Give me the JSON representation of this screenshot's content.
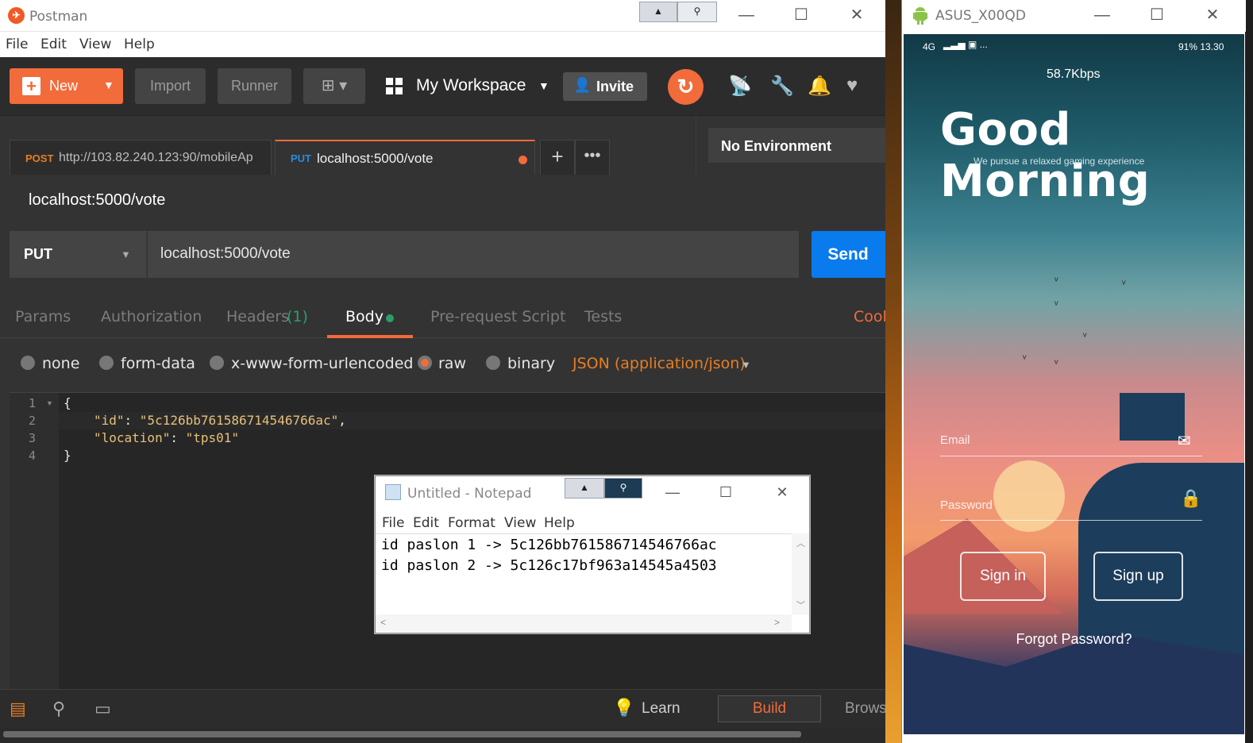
{
  "postman": {
    "window_title": "Postman",
    "menu": [
      "File",
      "Edit",
      "View",
      "Help"
    ],
    "header": {
      "new_label": "New",
      "import_label": "Import",
      "runner_label": "Runner",
      "workspace_label": "My Workspace",
      "invite_label": "Invite"
    },
    "tabs": [
      {
        "method": "POST",
        "url": "http://103.82.240.123:90/mobileAp",
        "method_color": "#e67e22"
      },
      {
        "method": "PUT",
        "url": "localhost:5000/vote",
        "method_color": "#2b8bd9",
        "unsaved": true
      }
    ],
    "environment": "No Environment",
    "request_title": "localhost:5000/vote",
    "method": "PUT",
    "url": "localhost:5000/vote",
    "send_label": "Send",
    "request_tabs": {
      "params": "Params",
      "authorization": "Authorization",
      "headers": "Headers",
      "headers_count": "(1)",
      "body": "Body",
      "prerequest": "Pre-request Script",
      "tests": "Tests",
      "cookies": "Cook"
    },
    "body_modes": {
      "none": "none",
      "form_data": "form-data",
      "urlencoded": "x-www-form-urlencoded",
      "raw": "raw",
      "binary": "binary",
      "content_type": "JSON (application/json)",
      "selected": "raw"
    },
    "editor": {
      "line_numbers": [
        "1",
        "2",
        "3",
        "4"
      ],
      "open_brace": "{",
      "line2_key": "\"id\"",
      "line2_value": "\"5c126bb761586714546766ac\"",
      "line3_key": "\"location\"",
      "line3_value": "\"tps01\"",
      "close_brace": "}"
    },
    "statusbar": {
      "learn": "Learn",
      "build": "Build",
      "browse": "Brows"
    },
    "accent_color": "#f26b3a",
    "send_color": "#097bed"
  },
  "notepad": {
    "title": "Untitled - Notepad",
    "menu": [
      "File",
      "Edit",
      "Format",
      "View",
      "Help"
    ],
    "lines": [
      "id paslon 1 -> 5c126bb761586714546766ac",
      "id paslon 2 -> 5c126c17bf963a14545a4503"
    ]
  },
  "android": {
    "window_title": "ASUS_X00QD",
    "status_left": "4G",
    "status_right": "91% 13.30",
    "speed": "58.7Kbps",
    "greeting": "Good Morning",
    "tagline": "We pursue a relaxed gaming experience",
    "email_label": "Email",
    "password_label": "Password",
    "signin_label": "Sign in",
    "signup_label": "Sign up",
    "forgot_label": "Forgot Password?"
  }
}
